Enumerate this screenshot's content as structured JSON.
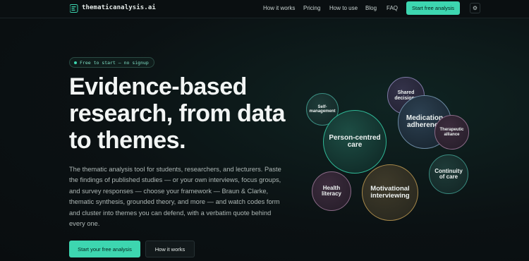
{
  "brand": {
    "name": "thematicanalysis.ai"
  },
  "nav": {
    "items": [
      {
        "label": "How it works"
      },
      {
        "label": "Pricing"
      },
      {
        "label": "How to use"
      },
      {
        "label": "Blog"
      },
      {
        "label": "FAQ"
      }
    ],
    "cta_label": "Start free analysis",
    "theme_toggle_icon": "gear-icon"
  },
  "hero": {
    "badge": "Free to start — no signup",
    "title_lines": [
      "Evidence-based",
      "research, from data",
      "to themes."
    ],
    "description": "The thematic analysis tool for students, researchers, and lecturers. Paste the findings of published studies — or your own interviews, focus groups, and survey responses — choose your framework — Braun & Clarke, thematic synthesis, grounded theory, and more — and watch codes form and cluster into themes you can defend, with a verbatim quote behind every one.",
    "primary_button": "Start your free analysis",
    "secondary_button": "How it works"
  },
  "themes": [
    {
      "label": "Self-\nmanagement"
    },
    {
      "label": "Shared\ndecisions"
    },
    {
      "label": "Person-centred\ncare"
    },
    {
      "label": "Medication\nadherence"
    },
    {
      "label": "Therapeutic\nalliance"
    },
    {
      "label": "Continuity\nof care"
    },
    {
      "label": "Health\nliteracy"
    },
    {
      "label": "Motivational\ninterviewing"
    }
  ],
  "colors": {
    "accent": "#3dd6b0",
    "background": "#0b1113"
  }
}
